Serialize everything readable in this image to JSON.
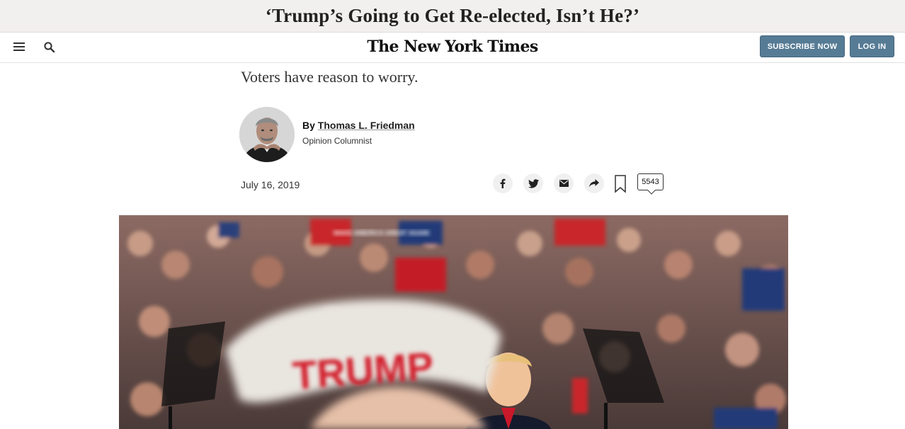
{
  "sticky_header": {
    "headline": "‘Trump’s Going to Get Re-elected, Isn’t He?’"
  },
  "masthead": {
    "logo": "The New York Times",
    "subscribe_label": "SUBSCRIBE NOW",
    "login_label": "LOG IN",
    "icons": {
      "menu": "hamburger-icon",
      "search": "search-icon"
    },
    "button_color": "#567b95"
  },
  "article": {
    "dek": "Voters have reason to worry.",
    "byline": {
      "prefix": "By",
      "author": "Thomas L. Friedman",
      "role": "Opinion Columnist"
    },
    "date": "July 16, 2019",
    "share": {
      "icons": [
        "facebook-icon",
        "twitter-icon",
        "email-icon",
        "share-icon",
        "bookmark-icon"
      ],
      "comment_count": "5543"
    },
    "photo": {
      "sign_text": "TRUMP",
      "placard_text": "MAKE AMERICA GREAT AGAIN"
    }
  }
}
